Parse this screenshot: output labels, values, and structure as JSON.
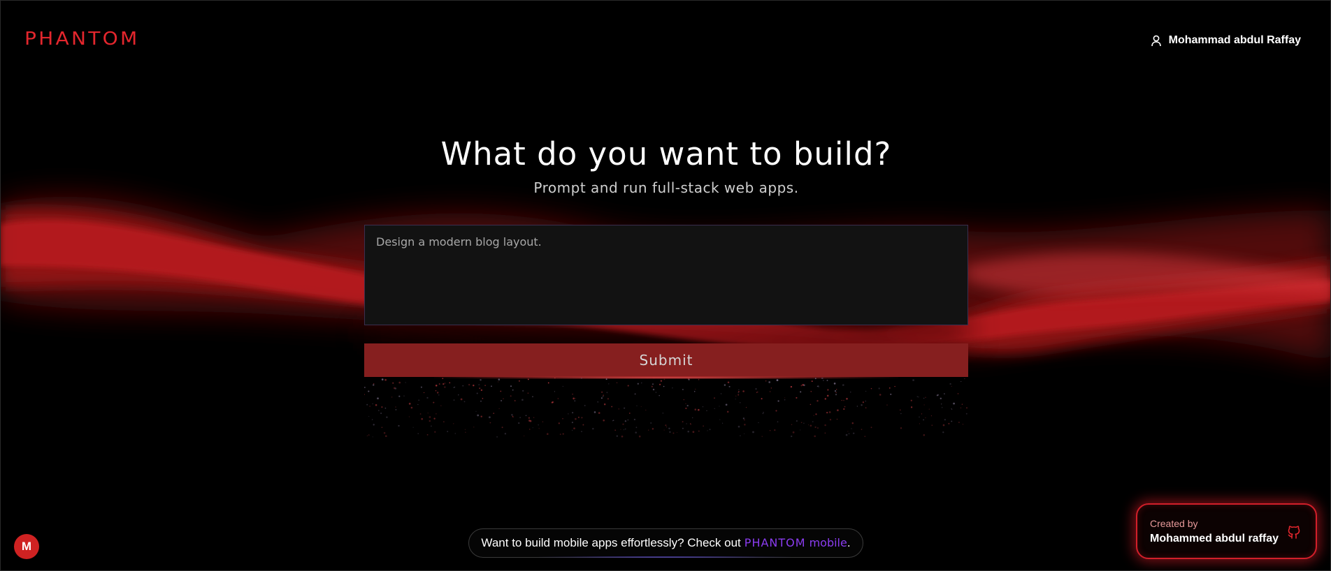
{
  "header": {
    "logo": "PHANTOM",
    "user_name": "Mohammad abdul Raffay",
    "user_icon": "user-icon"
  },
  "hero": {
    "title": "What do you want to build?",
    "subtitle": "Prompt and run full-stack web apps."
  },
  "prompt": {
    "value": "",
    "placeholder": "Design a modern blog layout."
  },
  "submit": {
    "label": "Submit"
  },
  "mobile_banner": {
    "text": "Want to build mobile apps effortlessly? Check out",
    "brand": "PHANTOM",
    "brand_suffix": "mobile",
    "period": "."
  },
  "avatar": {
    "initial": "M"
  },
  "credit": {
    "label": "Created by",
    "name": "Mohammed abdul raffay",
    "icon": "github-icon"
  },
  "colors": {
    "background": "#000000",
    "brand_red": "#e3262d",
    "submit_bg": "#861f1f",
    "mobile_accent": "#8b3cf0",
    "avatar_bg": "#cf2222"
  }
}
